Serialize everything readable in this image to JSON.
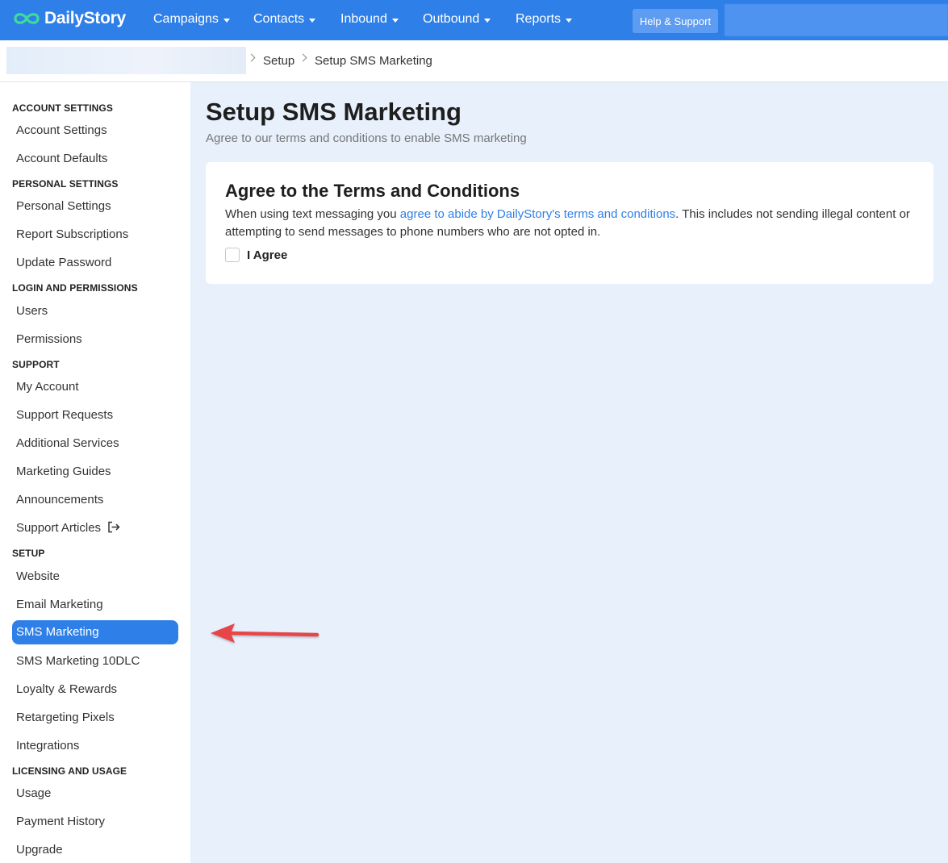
{
  "brand": {
    "name": "DailyStory"
  },
  "nav": {
    "items": [
      {
        "label": "Campaigns"
      },
      {
        "label": "Contacts"
      },
      {
        "label": "Inbound"
      },
      {
        "label": "Outbound"
      },
      {
        "label": "Reports"
      }
    ],
    "help_label": "Help & Support"
  },
  "breadcrumb": {
    "items": [
      "Setup",
      "Setup SMS Marketing"
    ]
  },
  "sidebar": {
    "sections": [
      {
        "title": "ACCOUNT SETTINGS",
        "items": [
          "Account Settings",
          "Account Defaults"
        ]
      },
      {
        "title": "PERSONAL SETTINGS",
        "items": [
          "Personal Settings",
          "Report Subscriptions",
          "Update Password"
        ]
      },
      {
        "title": "LOGIN AND PERMISSIONS",
        "items": [
          "Users",
          "Permissions"
        ]
      },
      {
        "title": "SUPPORT",
        "items": [
          "My Account",
          "Support Requests",
          "Additional Services",
          "Marketing Guides",
          "Announcements",
          "Support Articles"
        ]
      },
      {
        "title": "SETUP",
        "items": [
          "Website",
          "Email Marketing",
          "SMS Marketing",
          "SMS Marketing 10DLC",
          "Loyalty & Rewards",
          "Retargeting Pixels",
          "Integrations"
        ]
      },
      {
        "title": "LICENSING AND USAGE",
        "items": [
          "Usage",
          "Payment History",
          "Upgrade"
        ]
      }
    ],
    "active_item": "SMS Marketing"
  },
  "main": {
    "title": "Setup SMS Marketing",
    "subtitle": "Agree to our terms and conditions to enable SMS marketing",
    "card": {
      "title": "Agree to the Terms and Conditions",
      "text_before": "When using text messaging you ",
      "link_text": "agree to abide by DailyStory's terms and conditions",
      "text_after": ". This includes not sending illegal content or attempting to send messages to phone numbers who are not opted in.",
      "checkbox_label": "I Agree",
      "checked": false
    }
  },
  "colors": {
    "primary": "#2e7fe8",
    "content_bg": "#e7f0fb",
    "logo_green": "#3ddc97",
    "annotation_arrow": "#e8444a"
  },
  "icons": {
    "logo": "infinity-icon",
    "nav_dropdown": "caret-down-icon",
    "breadcrumb_separator": "chevron-right-icon",
    "external_link": "external-link-icon",
    "annotation": "red-arrow-left-icon"
  }
}
